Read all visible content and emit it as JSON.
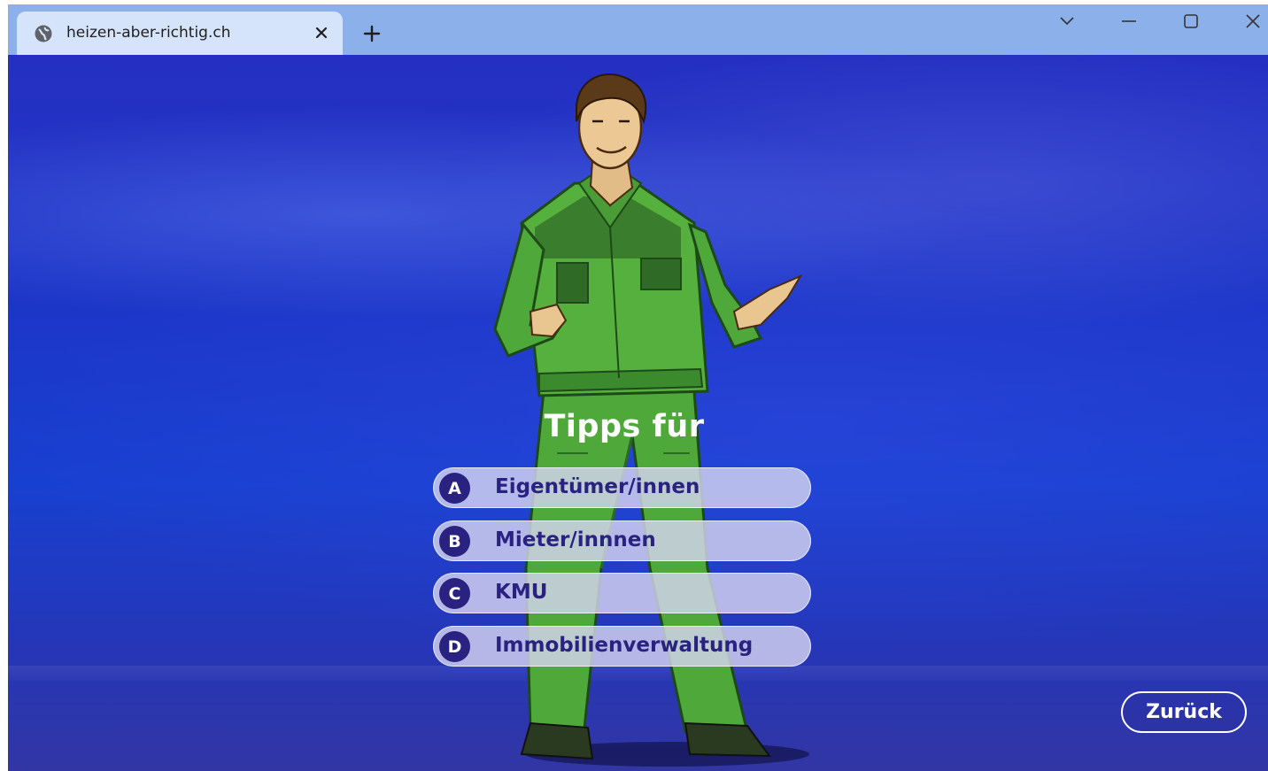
{
  "browser": {
    "tab_title": "heizen-aber-richtig.ch",
    "tab_icon": "globe-icon",
    "new_tab_icon": "plus-icon",
    "close_tab_icon": "close-icon",
    "controls": [
      "chevron-down-icon",
      "minimize-icon",
      "maximize-icon",
      "close-icon"
    ]
  },
  "page": {
    "heading": "Tipps für",
    "options": [
      {
        "badge": "A",
        "label": "Eigentümer/innen"
      },
      {
        "badge": "B",
        "label": "Mieter/innnen"
      },
      {
        "badge": "C",
        "label": "KMU"
      },
      {
        "badge": "D",
        "label": "Immobilienverwaltung"
      }
    ],
    "back_label": "Zurück"
  },
  "colors": {
    "titlebar": "#8bb0ea",
    "tab": "#d6e4fb",
    "background": "#1f2fc8",
    "option_bg": "#d6d4f0",
    "option_text": "#2a2280",
    "suit": "#4fa83a"
  }
}
